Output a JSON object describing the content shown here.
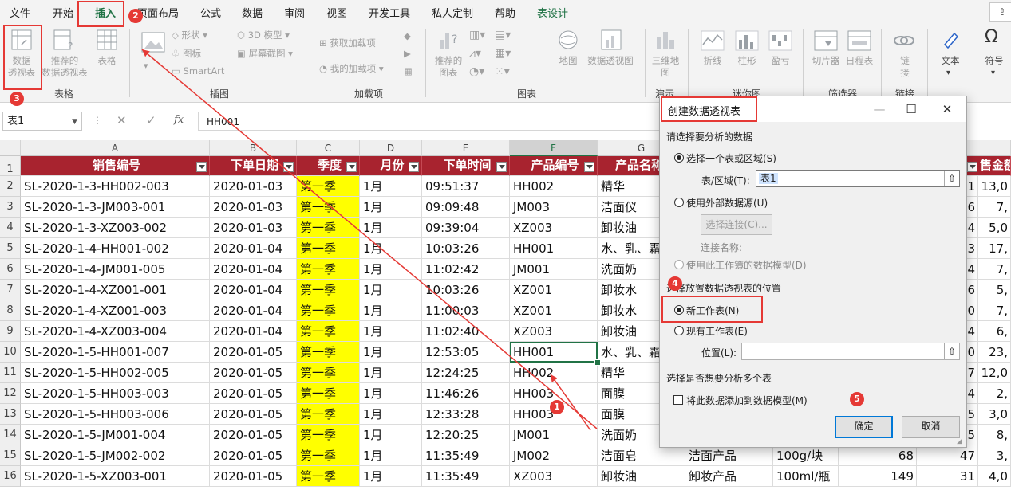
{
  "menu": {
    "items": [
      "文件",
      "开始",
      "插入",
      "页面布局",
      "公式",
      "数据",
      "审阅",
      "视图",
      "开发工具",
      "私人定制",
      "帮助",
      "表设计"
    ],
    "active_index": 2
  },
  "ribbon": {
    "pivot_label_1": "数据",
    "pivot_label_2": "透视表",
    "rec_pivot_1": "推荐的",
    "rec_pivot_2": "数据透视表",
    "table_btn": "表格",
    "shapes": "形状",
    "icons": "图标",
    "smartart": "SmartArt",
    "model3d": "3D 模型",
    "screenshot": "屏幕截图",
    "get_addins": "获取加载项",
    "my_addins": "我的加载项",
    "rec_charts_1": "推荐的",
    "rec_charts_2": "图表",
    "map": "地图",
    "pivot_chart": "数据透视图",
    "map3d_1": "三维地",
    "map3d_2": "图",
    "line": "折线",
    "column": "柱形",
    "winloss": "盈亏",
    "slicer": "切片器",
    "timeline": "日程表",
    "link_1": "链",
    "link_2": "接",
    "text": "文本",
    "symbol": "符号",
    "groups": {
      "tables": "表格",
      "illustrations": "插图",
      "addins": "加载项",
      "charts": "图表",
      "tours": "演示",
      "sparklines": "迷你图",
      "filters": "筛选器",
      "links": "链接"
    }
  },
  "formula_bar": {
    "name_box": "表1",
    "fx": "fx",
    "value": "HH001"
  },
  "sheet": {
    "columns": [
      "A",
      "B",
      "C",
      "D",
      "E",
      "F",
      "G"
    ],
    "header_row": [
      "销售编号",
      "下单日期",
      "季度",
      "月份",
      "下单时间",
      "产品编号",
      "产品名称"
    ],
    "right_header": "售金额",
    "rows": [
      {
        "n": "2",
        "a": "SL-2020-1-3-HH002-003",
        "b": "2020-01-03",
        "c": "第一季",
        "d": "1月",
        "e": "09:51:37",
        "f": "HH002",
        "g": "精华",
        "k": "1",
        "l": "13,0"
      },
      {
        "n": "3",
        "a": "SL-2020-1-3-JM003-001",
        "b": "2020-01-03",
        "c": "第一季",
        "d": "1月",
        "e": "09:09:48",
        "f": "JM003",
        "g": "洁面仪",
        "k": "6",
        "l": "7,"
      },
      {
        "n": "4",
        "a": "SL-2020-1-3-XZ003-002",
        "b": "2020-01-03",
        "c": "第一季",
        "d": "1月",
        "e": "09:39:04",
        "f": "XZ003",
        "g": "卸妆油",
        "k": "4",
        "l": "5,0"
      },
      {
        "n": "5",
        "a": "SL-2020-1-4-HH001-002",
        "b": "2020-01-04",
        "c": "第一季",
        "d": "1月",
        "e": "10:03:26",
        "f": "HH001",
        "g": "水、乳、霜",
        "k": "3",
        "l": "17,"
      },
      {
        "n": "6",
        "a": "SL-2020-1-4-JM001-005",
        "b": "2020-01-04",
        "c": "第一季",
        "d": "1月",
        "e": "11:02:42",
        "f": "JM001",
        "g": "洗面奶",
        "k": "4",
        "l": "7,"
      },
      {
        "n": "7",
        "a": "SL-2020-1-4-XZ001-001",
        "b": "2020-01-04",
        "c": "第一季",
        "d": "1月",
        "e": "10:03:26",
        "f": "XZ001",
        "g": "卸妆水",
        "k": "6",
        "l": "5,"
      },
      {
        "n": "8",
        "a": "SL-2020-1-4-XZ001-003",
        "b": "2020-01-04",
        "c": "第一季",
        "d": "1月",
        "e": "11:00:03",
        "f": "XZ001",
        "g": "卸妆水",
        "k": "0",
        "l": "7,"
      },
      {
        "n": "9",
        "a": "SL-2020-1-4-XZ003-004",
        "b": "2020-01-04",
        "c": "第一季",
        "d": "1月",
        "e": "11:02:40",
        "f": "XZ003",
        "g": "卸妆油",
        "k": "4",
        "l": "6,"
      },
      {
        "n": "10",
        "a": "SL-2020-1-5-HH001-007",
        "b": "2020-01-05",
        "c": "第一季",
        "d": "1月",
        "e": "12:53:05",
        "f": "HH001",
        "g": "水、乳、霜",
        "k": "0",
        "l": "23,"
      },
      {
        "n": "11",
        "a": "SL-2020-1-5-HH002-005",
        "b": "2020-01-05",
        "c": "第一季",
        "d": "1月",
        "e": "12:24:25",
        "f": "HH002",
        "g": "精华",
        "k": "7",
        "l": "12,0"
      },
      {
        "n": "12",
        "a": "SL-2020-1-5-HH003-003",
        "b": "2020-01-05",
        "c": "第一季",
        "d": "1月",
        "e": "11:46:26",
        "f": "HH003",
        "g": "面膜",
        "k": "4",
        "l": "2,"
      },
      {
        "n": "13",
        "a": "SL-2020-1-5-HH003-006",
        "b": "2020-01-05",
        "c": "第一季",
        "d": "1月",
        "e": "12:33:28",
        "f": "HH003",
        "g": "面膜",
        "k": "5",
        "l": "3,0"
      },
      {
        "n": "14",
        "a": "SL-2020-1-5-JM001-004",
        "b": "2020-01-05",
        "c": "第一季",
        "d": "1月",
        "e": "12:20:25",
        "f": "JM001",
        "g": "洗面奶",
        "k": "5",
        "l": "8,"
      },
      {
        "n": "15",
        "a": "SL-2020-1-5-JM002-002",
        "b": "2020-01-05",
        "c": "第一季",
        "d": "1月",
        "e": "11:35:49",
        "f": "JM002",
        "g": "洁面皂",
        "h": "洁面产品",
        "i": "100g/块",
        "j": "68",
        "k": "47",
        "l": "3,"
      },
      {
        "n": "16",
        "a": "SL-2020-1-5-XZ003-001",
        "b": "2020-01-05",
        "c": "第一季",
        "d": "1月",
        "e": "11:35:49",
        "f": "XZ003",
        "g": "卸妆油",
        "h": "卸妆产品",
        "i": "100ml/瓶",
        "j": "149",
        "k": "31",
        "l": "4,0"
      }
    ]
  },
  "dialog": {
    "title": "创建数据透视表",
    "section1": "请选择要分析的数据",
    "opt_range": "选择一个表或区域(S)",
    "range_label": "表/区域(T):",
    "range_value": "表1",
    "opt_external": "使用外部数据源(U)",
    "choose_conn": "选择连接(C)...",
    "conn_name": "连接名称:",
    "opt_model": "使用此工作簿的数据模型(D)",
    "section2": "选择放置数据透视表的位置",
    "opt_new": "新工作表(N)",
    "opt_existing": "现有工作表(E)",
    "location_label": "位置(L):",
    "location_value": "",
    "section3": "选择是否想要分析多个表",
    "add_model": "将此数据添加到数据模型(M)",
    "ok": "确定",
    "cancel": "取消"
  },
  "annotations": {
    "badges": [
      "1",
      "2",
      "3",
      "4",
      "5"
    ]
  },
  "colors": {
    "header_fill": "#a8232f",
    "season_fill": "#ffff00",
    "excel_green": "#217346",
    "annotation_red": "#e53935"
  }
}
